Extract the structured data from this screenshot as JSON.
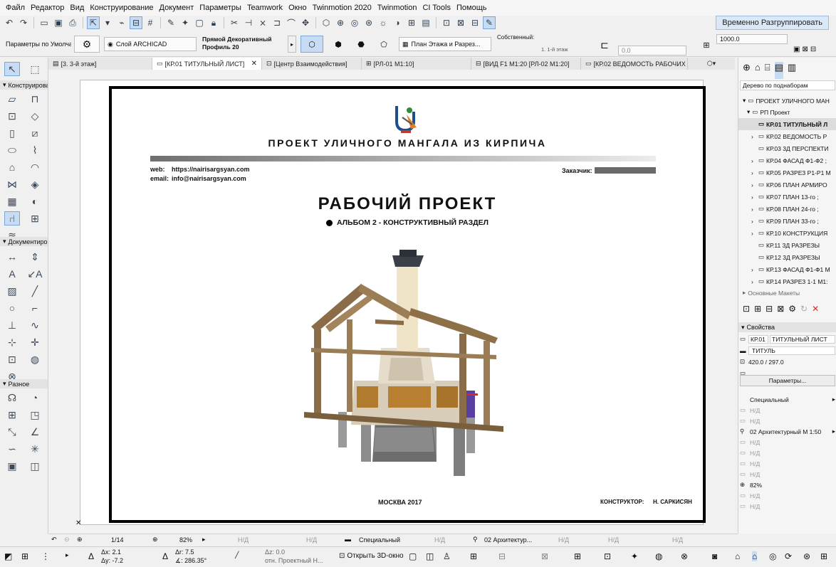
{
  "menu": [
    "Файл",
    "Редактор",
    "Вид",
    "Конструирование",
    "Документ",
    "Параметры",
    "Teamwork",
    "Окно",
    "Twinmotion 2020",
    "Twinmotion",
    "CI Tools",
    "Помощь"
  ],
  "toolbar": {
    "ungroup_label": "Временно Разгруппировать"
  },
  "infobox": {
    "defaults_label": "Параметры по Умолчанию",
    "layer_label": "Слой ARCHICAD",
    "profile_label_1": "Прямой Декоративный",
    "profile_label_2": "Профиль 20",
    "view_label": "План Этажа и Разрез...",
    "own_label": "Собственный:",
    "floor_label": "1. 1-й этаж",
    "offset_value": "0.0",
    "value_field": "1000.0"
  },
  "tabs": [
    "[3. 3-й этаж]",
    "[КР.01 ТИТУЛЬНЫЙ ЛИСТ]",
    "[Центр Взаимодействия]",
    "[РЛ-01 М1:10]",
    "[ВИД F1 М1:20 [РЛ-02 М1:20]",
    "[КР.02 ВЕДОМОСТЬ РАБОЧИХ ..."
  ],
  "toolbox": {
    "sec_construct": "Конструирова",
    "sec_document": "Документиро",
    "sec_misc": "Разное"
  },
  "sheet": {
    "project_title": "ПРОЕКТ УЛИЧНОГО МАНГАЛА ИЗ КИРПИЧА",
    "web_label": "web:",
    "web_value": "https://nairisargsyan.com",
    "email_label": "email:",
    "email_value": "info@nairisargsyan.com",
    "client_label": "Заказчик:",
    "main_title": "РАБОЧИЙ ПРОЕКТ",
    "album": "АЛЬБОМ 2  -  КОНСТРУКТИВНЫЙ РАЗДЕЛ",
    "city": "МОСКВА 2017",
    "designer_label": "КОНСТРУКТОР:",
    "designer_name": "Н. САРКИСЯН"
  },
  "navigator": {
    "header": "Дерево по поднаборам",
    "root": "ПРОЕКТ УЛИЧНОГО МАН",
    "set": "РП Проект",
    "items": [
      "КР.01 ТИТУЛЬНЫЙ Л",
      "КР.02 ВЕДОМОСТЬ Р",
      "КР.03 3Д ПЕРСПЕКТИ",
      "КР.04 ФАСАД Ф1-Ф2 ;",
      "КР.05 РАЗРЕЗ Р1-Р1 М",
      "КР.06 ПЛАН АРМИРО",
      "КР.07  ПЛАН 13-го ;",
      "КР.08  ПЛАН 24-го ;",
      "КР.09  ПЛАН 33-го ;",
      "КР.10 КОНСТРУКЦИЯ",
      "КР.11 3Д РАЗРЕЗЫ",
      "КР.12 3Д РАЗРЕЗЫ",
      "КР.13 ФАСАД Ф1-Ф1 М",
      "КР.14 РАЗРЕЗ 1-1 М1:"
    ],
    "next_set": "Основные Макеты"
  },
  "properties": {
    "header": "Свойства",
    "id": "КР.01",
    "name": "ТИТУЛЬНЫЙ ЛИСТ",
    "master": "ТИТУЛЬ",
    "size": "420.0 / 297.0",
    "params_button": "Параметры...",
    "special": "Специальный",
    "nd": "Н/Д",
    "pen_set": "02 Архитектурный М 1:50",
    "zoom": "82%"
  },
  "bottom": {
    "page": "1/14",
    "zoom": "82%",
    "nd": "Н/Д",
    "special": "Специальный",
    "pens": "02 Архитектур...",
    "dx": "Δx: 2.1",
    "dy": "Δy: -7.2",
    "dr": "Δr: 7.5",
    "angle": "∡: 286.35°",
    "dz": "Δz: 0.0",
    "ref": "отн. Проектный Н...",
    "open3d": "Открыть 3D-окно"
  }
}
